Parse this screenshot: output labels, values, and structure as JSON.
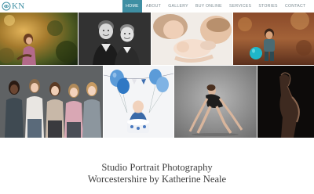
{
  "header": {
    "logo_text": "KN",
    "nav": [
      {
        "label": "Home",
        "active": true
      },
      {
        "label": "About",
        "active": false
      },
      {
        "label": "Gallery",
        "active": false
      },
      {
        "label": "Buy Online",
        "active": false
      },
      {
        "label": "Services",
        "active": false
      },
      {
        "label": "Stories",
        "active": false
      },
      {
        "label": "Contact",
        "active": false
      }
    ]
  },
  "colors": {
    "accent": "#3f8fa3",
    "nav_text": "#7a8a91",
    "headline_text": "#3d3d3d"
  },
  "gallery": {
    "photos": [
      {
        "name": "girl-in-autumn-woodland-photo"
      },
      {
        "name": "two-brothers-black-and-white-photo"
      },
      {
        "name": "newborn-with-parents-photo"
      },
      {
        "name": "toddler-with-balloon-photo"
      },
      {
        "name": "five-girls-group-photo"
      },
      {
        "name": "first-birthday-cake-smash-photo"
      },
      {
        "name": "dancer-pose-photo"
      },
      {
        "name": "maternity-silhouette-photo"
      }
    ]
  },
  "headline": {
    "line1": "Studio Portrait Photography",
    "line2": "Worcestershire by Katherine Neale"
  }
}
